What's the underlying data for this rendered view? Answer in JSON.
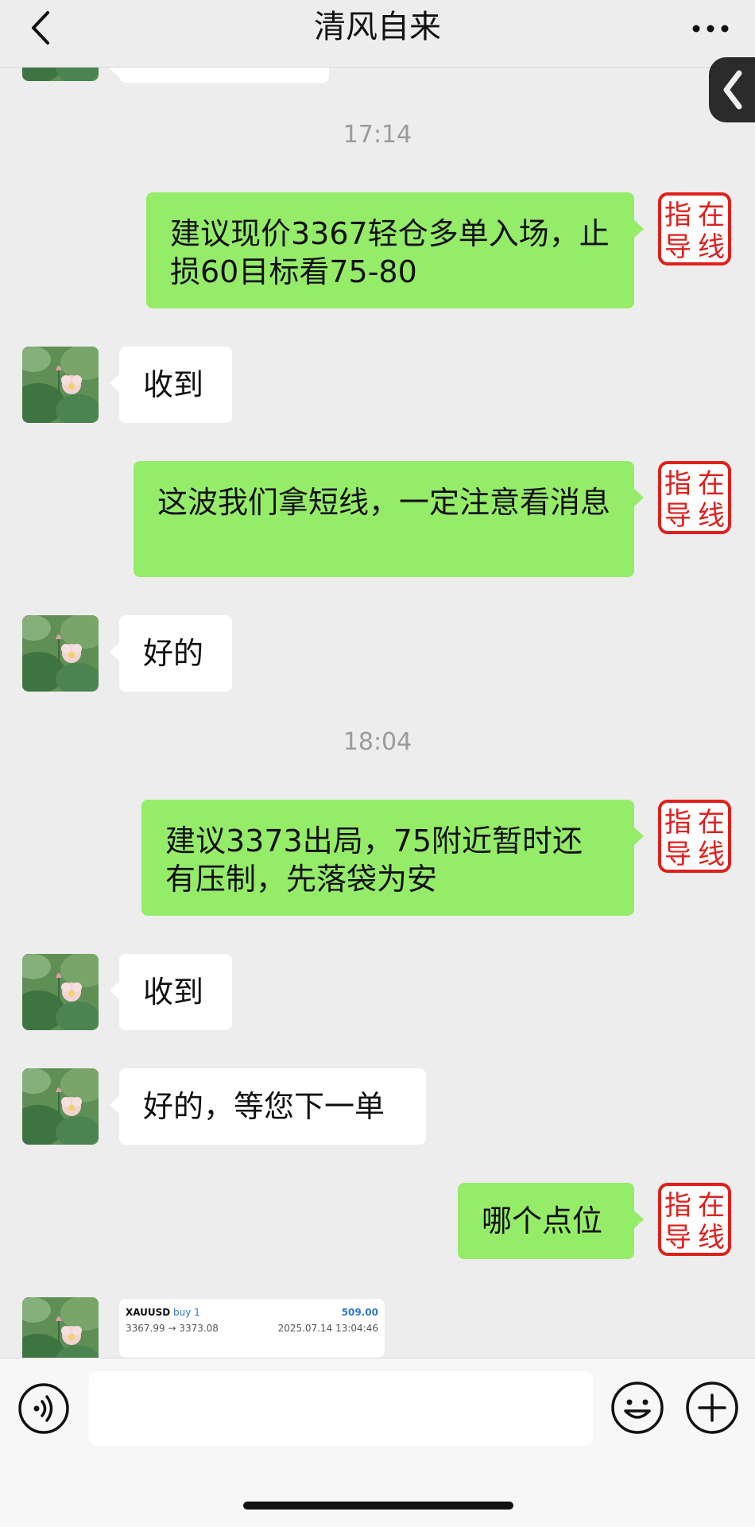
{
  "header": {
    "title": "清风自来"
  },
  "seal": {
    "chars": [
      "指",
      "在",
      "导",
      "线"
    ]
  },
  "timestamps": [
    "17:14",
    "18:04"
  ],
  "messages": [
    {
      "side": "right",
      "text": "建议现价3367轻仓多单入场，止损60目标看75-80"
    },
    {
      "side": "left",
      "text": "收到"
    },
    {
      "side": "right",
      "text": "这波我们拿短线，一定注意看消息"
    },
    {
      "side": "left",
      "text": "好的"
    },
    {
      "side": "right",
      "text": "建议3373出局，75附近暂时还有压制，先落袋为安"
    },
    {
      "side": "left",
      "text": "收到"
    },
    {
      "side": "left",
      "text": "好的，等您下一单"
    },
    {
      "side": "right",
      "text": "哪个点位"
    }
  ],
  "trade_card": {
    "symbol": "XAUUSD",
    "side": "buy 1",
    "profit": "509.00",
    "prices": "3367.99 → 3373.08",
    "time": "2025.07.14 13:04:46"
  },
  "input": {
    "placeholder": ""
  },
  "colors": {
    "sent_bubble": "#95ec69",
    "received_bubble": "#ffffff",
    "seal_red": "#e0201c",
    "background": "#ededed"
  }
}
